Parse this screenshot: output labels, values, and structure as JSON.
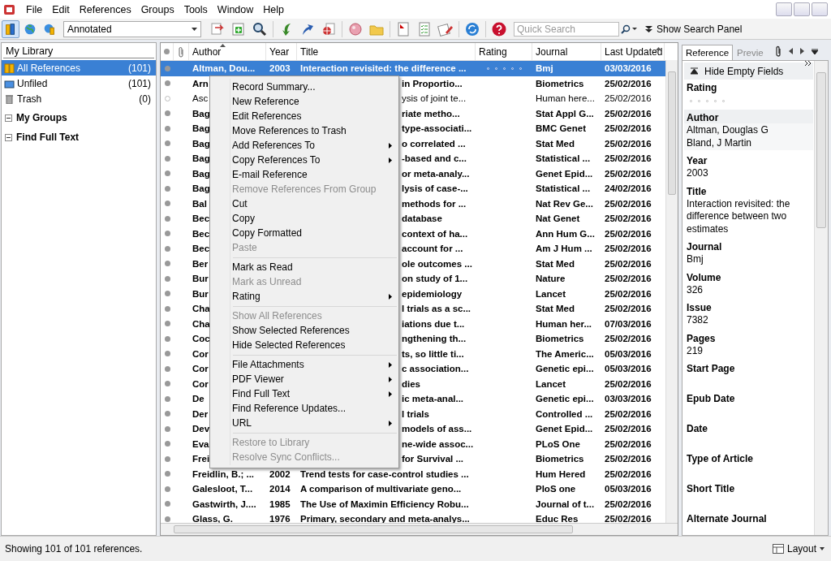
{
  "menu_bar": [
    "File",
    "Edit",
    "References",
    "Groups",
    "Tools",
    "Window",
    "Help"
  ],
  "toolbar": {
    "modes": [
      {
        "selected": true
      },
      {
        "selected": false
      },
      {
        "selected": false
      }
    ],
    "style": "Annotated",
    "search": {
      "placeholder": "Quick Search"
    },
    "search_panel": "Show Search Panel"
  },
  "sidebar": {
    "header": "My Library",
    "items": [
      {
        "label": "All References",
        "count": "(101)",
        "selected": true
      },
      {
        "label": "Unfiled",
        "count": "(101)",
        "selected": false
      },
      {
        "label": "Trash",
        "count": "(0)",
        "selected": false
      }
    ],
    "groups": [
      {
        "label": "My Groups",
        "expanded": true
      },
      {
        "label": "Find Full Text",
        "expanded": true
      }
    ]
  },
  "table": {
    "columns": [
      "Author",
      "Year",
      "Title",
      "Rating",
      "Journal",
      "Last Updated"
    ],
    "rows": [
      {
        "kind": "full",
        "selected": true,
        "read": false,
        "author": "Altman, Dou...",
        "year": "2003",
        "title": "Interaction revisited: the difference ...",
        "stars": 0,
        "journal": "Bmj",
        "updated": "03/03/2016"
      },
      {
        "kind": "covered",
        "selected": false,
        "read": false,
        "author": "Arn",
        "title": "in Proportio...",
        "journal": "Biometrics",
        "updated": "25/02/2016"
      },
      {
        "kind": "covered",
        "selected": false,
        "read": true,
        "author": "Asc",
        "title": "ysis of joint te...",
        "journal": "Human here...",
        "updated": "25/02/2016"
      },
      {
        "kind": "covered",
        "selected": false,
        "read": false,
        "author": "Bag",
        "title": "riate metho...",
        "journal": "Stat Appl G...",
        "updated": "25/02/2016"
      },
      {
        "kind": "covered",
        "selected": false,
        "read": false,
        "author": "Bag",
        "title": "type-associati...",
        "journal": "BMC Genet",
        "updated": "25/02/2016"
      },
      {
        "kind": "covered",
        "selected": false,
        "read": false,
        "author": "Bag",
        "title": "o correlated ...",
        "journal": "Stat Med",
        "updated": "25/02/2016"
      },
      {
        "kind": "covered",
        "selected": false,
        "read": false,
        "author": "Bag",
        "title": "-based and c...",
        "journal": "Statistical ...",
        "updated": "25/02/2016"
      },
      {
        "kind": "covered",
        "selected": false,
        "read": false,
        "author": "Bag",
        "title": "or meta-analy...",
        "journal": "Genet Epid...",
        "updated": "25/02/2016"
      },
      {
        "kind": "covered",
        "selected": false,
        "read": false,
        "author": "Bag",
        "title": "lysis of case-...",
        "journal": "Statistical ...",
        "updated": "24/02/2016"
      },
      {
        "kind": "covered",
        "selected": false,
        "read": false,
        "author": "Bal",
        "title": "methods for ...",
        "journal": "Nat Rev Ge...",
        "updated": "25/02/2016"
      },
      {
        "kind": "covered",
        "selected": false,
        "read": false,
        "author": "Bec",
        "title": "database",
        "journal": "Nat Genet",
        "updated": "25/02/2016"
      },
      {
        "kind": "covered",
        "selected": false,
        "read": false,
        "author": "Bec",
        "title": "context of ha...",
        "journal": "Ann Hum G...",
        "updated": "25/02/2016"
      },
      {
        "kind": "covered",
        "selected": false,
        "read": false,
        "author": "Bec",
        "title": "account for ...",
        "journal": "Am J Hum ...",
        "updated": "25/02/2016"
      },
      {
        "kind": "covered",
        "selected": false,
        "read": false,
        "author": "Ber",
        "title": "ole outcomes ...",
        "journal": "Stat Med",
        "updated": "25/02/2016"
      },
      {
        "kind": "covered",
        "selected": false,
        "read": false,
        "author": "Bur",
        "title": "on study of 1...",
        "journal": "Nature",
        "updated": "25/02/2016"
      },
      {
        "kind": "covered",
        "selected": false,
        "read": false,
        "author": "Bur",
        "title": "epidemiology",
        "journal": "Lancet",
        "updated": "25/02/2016"
      },
      {
        "kind": "covered",
        "selected": false,
        "read": false,
        "author": "Cha",
        "title": "l trials as a sc...",
        "journal": "Stat Med",
        "updated": "25/02/2016"
      },
      {
        "kind": "covered",
        "selected": false,
        "read": false,
        "author": "Cha",
        "title": "iations due t...",
        "journal": "Human her...",
        "updated": "07/03/2016"
      },
      {
        "kind": "covered",
        "selected": false,
        "read": false,
        "author": "Coc",
        "title": "ngthening th...",
        "journal": "Biometrics",
        "updated": "25/02/2016"
      },
      {
        "kind": "covered",
        "selected": false,
        "read": false,
        "author": "Cor",
        "title": "ts, so little ti...",
        "journal": "The Americ...",
        "updated": "05/03/2016"
      },
      {
        "kind": "covered",
        "selected": false,
        "read": false,
        "author": "Cor",
        "title": "c association...",
        "journal": "Genetic epi...",
        "updated": "05/03/2016"
      },
      {
        "kind": "covered",
        "selected": false,
        "read": false,
        "author": "Cor",
        "title": "dies",
        "journal": "Lancet",
        "updated": "25/02/2016"
      },
      {
        "kind": "covered",
        "selected": false,
        "read": false,
        "author": "De",
        "title": "ic meta-anal...",
        "journal": "Genetic epi...",
        "updated": "03/03/2016"
      },
      {
        "kind": "covered",
        "selected": false,
        "read": false,
        "author": "Der",
        "title": "l trials",
        "journal": "Controlled ...",
        "updated": "25/02/2016"
      },
      {
        "kind": "covered",
        "selected": false,
        "read": false,
        "author": "Dev",
        "title": "models of ass...",
        "journal": "Genet Epid...",
        "updated": "25/02/2016"
      },
      {
        "kind": "covered",
        "selected": false,
        "read": false,
        "author": "Eva",
        "title": "ne-wide assoc...",
        "journal": "PLoS One",
        "updated": "25/02/2016"
      },
      {
        "kind": "covered",
        "selected": false,
        "read": false,
        "author": "Frei",
        "title": "for Survival ...",
        "journal": "Biometrics",
        "updated": "25/02/2016"
      },
      {
        "kind": "full",
        "selected": false,
        "read": false,
        "author": "Freidlin, B.; ...",
        "year": "2002",
        "title": "Trend tests for case-control studies ...",
        "journal": "Hum Hered",
        "updated": "25/02/2016"
      },
      {
        "kind": "full",
        "selected": false,
        "read": false,
        "author": "Galesloot, T...",
        "year": "2014",
        "title": "A comparison of multivariate geno...",
        "journal": "PloS one",
        "updated": "05/03/2016"
      },
      {
        "kind": "full",
        "selected": false,
        "read": false,
        "author": "Gastwirth, J....",
        "year": "1985",
        "title": "The Use of Maximin Efficiency Robu...",
        "journal": "Journal of t...",
        "updated": "25/02/2016"
      },
      {
        "kind": "full",
        "selected": false,
        "read": false,
        "author": "Glass, G.",
        "year": "1976",
        "title": "Primary, secondary and meta-analys...",
        "journal": "Educ Res",
        "updated": "25/02/2016"
      }
    ]
  },
  "context_menu": [
    {
      "kind": "item",
      "label": "Record Summary...",
      "disabled": false,
      "submenu": false
    },
    {
      "kind": "item",
      "label": "New Reference",
      "disabled": false,
      "submenu": false
    },
    {
      "kind": "item",
      "label": "Edit References",
      "disabled": false,
      "submenu": false
    },
    {
      "kind": "item",
      "label": "Move References to Trash",
      "disabled": false,
      "submenu": false
    },
    {
      "kind": "item",
      "label": "Add References To",
      "disabled": false,
      "submenu": true
    },
    {
      "kind": "item",
      "label": "Copy References To",
      "disabled": false,
      "submenu": true
    },
    {
      "kind": "item",
      "label": "E-mail Reference",
      "disabled": false,
      "submenu": false
    },
    {
      "kind": "item",
      "label": "Remove References From Group",
      "disabled": true,
      "submenu": false
    },
    {
      "kind": "item",
      "label": "Cut",
      "disabled": false,
      "submenu": false
    },
    {
      "kind": "item",
      "label": "Copy",
      "disabled": false,
      "submenu": false
    },
    {
      "kind": "item",
      "label": "Copy Formatted",
      "disabled": false,
      "submenu": false
    },
    {
      "kind": "item",
      "label": "Paste",
      "disabled": true,
      "submenu": false
    },
    {
      "kind": "separator"
    },
    {
      "kind": "item",
      "label": "Mark as Read",
      "disabled": false,
      "submenu": false
    },
    {
      "kind": "item",
      "label": "Mark as Unread",
      "disabled": true,
      "submenu": false
    },
    {
      "kind": "item",
      "label": "Rating",
      "disabled": false,
      "submenu": true
    },
    {
      "kind": "separator"
    },
    {
      "kind": "item",
      "label": "Show All References",
      "disabled": true,
      "submenu": false
    },
    {
      "kind": "item",
      "label": "Show Selected References",
      "disabled": false,
      "submenu": false
    },
    {
      "kind": "item",
      "label": "Hide Selected References",
      "disabled": false,
      "submenu": false
    },
    {
      "kind": "separator"
    },
    {
      "kind": "item",
      "label": "File Attachments",
      "disabled": false,
      "submenu": true
    },
    {
      "kind": "item",
      "label": "PDF Viewer",
      "disabled": false,
      "submenu": true
    },
    {
      "kind": "item",
      "label": "Find Full Text",
      "disabled": false,
      "submenu": true
    },
    {
      "kind": "item",
      "label": "Find Reference Updates...",
      "disabled": false,
      "submenu": false
    },
    {
      "kind": "item",
      "label": "URL",
      "disabled": false,
      "submenu": true
    },
    {
      "kind": "separator"
    },
    {
      "kind": "item",
      "label": "Restore to Library",
      "disabled": true,
      "submenu": false
    },
    {
      "kind": "item",
      "label": "Resolve Sync Conflicts...",
      "disabled": true,
      "submenu": false
    }
  ],
  "reference_panel": {
    "tabs": [
      {
        "label": "Reference",
        "selected": true
      },
      {
        "label": "Previe",
        "selected": false
      }
    ],
    "hide_button": "Hide Empty Fields",
    "fields": [
      {
        "kind": "rating",
        "label": "Rating",
        "stars": 0,
        "selected": false
      },
      {
        "kind": "text",
        "label": "Author",
        "values": [
          "Altman, Douglas G",
          "Bland, J Martin"
        ],
        "selected": true
      },
      {
        "kind": "text",
        "label": "Year",
        "values": [
          "2003"
        ],
        "selected": false
      },
      {
        "kind": "text",
        "label": "Title",
        "values": [
          "Interaction revisited: the difference between two estimates"
        ],
        "selected": false
      },
      {
        "kind": "text",
        "label": "Journal",
        "values": [
          "Bmj"
        ],
        "selected": false
      },
      {
        "kind": "text",
        "label": "Volume",
        "values": [
          "326"
        ],
        "selected": false
      },
      {
        "kind": "text",
        "label": "Issue",
        "values": [
          "7382"
        ],
        "selected": false
      },
      {
        "kind": "text",
        "label": "Pages",
        "values": [
          "219"
        ],
        "selected": false
      },
      {
        "kind": "text",
        "label": "Start Page",
        "selected": false
      },
      {
        "kind": "text",
        "label": "Epub Date",
        "selected": false
      },
      {
        "kind": "text",
        "label": "Date",
        "selected": false
      },
      {
        "kind": "text",
        "label": "Type of Article",
        "selected": false
      },
      {
        "kind": "text",
        "label": "Short Title",
        "selected": false
      },
      {
        "kind": "text",
        "label": "Alternate Journal",
        "selected": false
      }
    ]
  },
  "status_bar": {
    "text": "Showing 101 of 101 references.",
    "layout": "Layout"
  }
}
